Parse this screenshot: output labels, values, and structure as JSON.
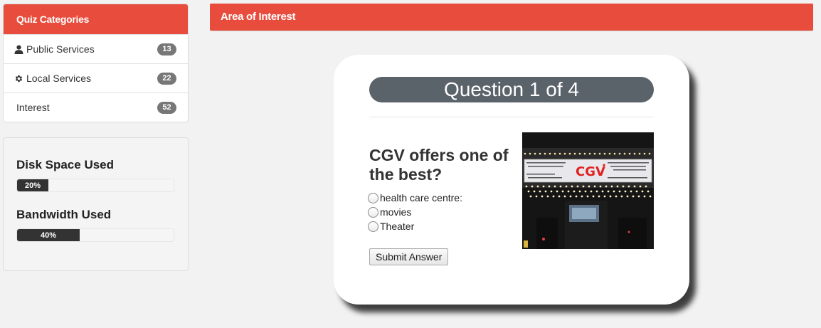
{
  "sidebar": {
    "categories_header": "Quiz Categories",
    "items": [
      {
        "label": "Public Services",
        "count": "13",
        "icon": "user-icon"
      },
      {
        "label": "Local Services",
        "count": "22",
        "icon": "gear-icon"
      },
      {
        "label": "Interest",
        "count": "52",
        "icon": ""
      }
    ],
    "usage": {
      "disk_label": "Disk Space Used",
      "disk_value": "20%",
      "disk_fraction": 0.2,
      "bandwidth_label": "Bandwidth Used",
      "bandwidth_value": "40%",
      "bandwidth_fraction": 0.4
    }
  },
  "main": {
    "header": "Area of Interest",
    "quiz": {
      "counter": "Question 1 of 4",
      "question": "CGV offers one of the best?",
      "options": [
        "health care centre:",
        "movies",
        "Theater"
      ],
      "submit_label": "Submit Answer",
      "image": {
        "brand_logo_text": "CGV",
        "description_icon": "cinema-marquee-photo"
      }
    }
  },
  "colors": {
    "accent": "#e74c3c",
    "counter_bg": "#5a626a",
    "progress_fill": "#333333",
    "badge": "#777777"
  }
}
